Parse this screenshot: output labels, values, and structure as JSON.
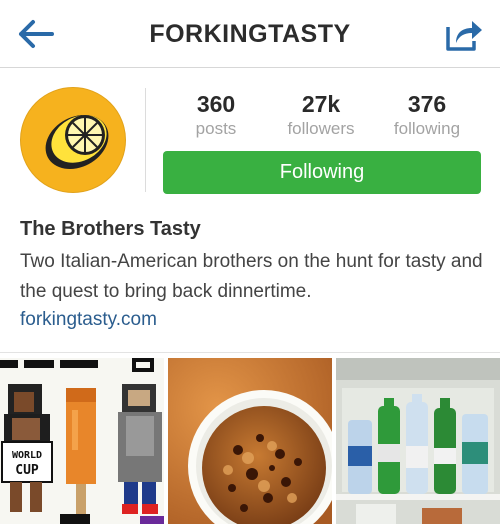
{
  "header": {
    "title": "FORKINGTASTY",
    "back_icon": "back-arrow-icon",
    "share_icon": "share-icon"
  },
  "profile": {
    "avatar_icon": "lemon-icon",
    "stats": [
      {
        "value": "360",
        "label": "posts"
      },
      {
        "value": "27k",
        "label": "followers"
      },
      {
        "value": "376",
        "label": "following"
      }
    ],
    "follow_button": "Following",
    "name": "The Brothers Tasty",
    "bio": "Two Italian-American brothers on the hunt for tasty and the quest to bring back dinnertime.",
    "website": "forkingtasty.com"
  },
  "grid": {
    "tiles": [
      {
        "description_icon": "pixel-art-characters-image",
        "sign_text": "WORLD CUP"
      },
      {
        "description_icon": "bread-pudding-image"
      },
      {
        "description_icon": "fridge-bottles-image"
      }
    ]
  },
  "colors": {
    "accent_blue": "#2a6aa8",
    "follow_green": "#39b041",
    "link_blue": "#2b5d8e",
    "avatar_yellow": "#f6b21e"
  }
}
